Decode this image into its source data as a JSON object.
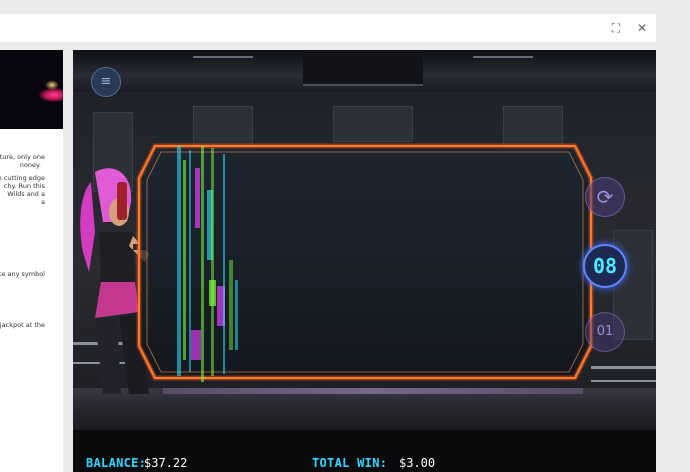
{
  "topbar": {
    "expand_icon": "⛶",
    "close_icon": "✕"
  },
  "left_panel": {
    "lines": [
      "ature, only one",
      "noney.",
      "n cutting edge",
      "chy. Run this",
      "Wilds and a",
      "a",
      "ate any symbol",
      "jackpot at the"
    ]
  },
  "game": {
    "menu_icon": "≡",
    "spin_icon": "⟳",
    "auto_count": "08",
    "bet_label": "01",
    "balance_label": "BALANCE:",
    "balance_value": "$37.22",
    "total_win_label": "TOTAL WIN:",
    "total_win_value": "$3.00"
  },
  "colors": {
    "frame_orange": "#ff5a14",
    "status_cyan": "#2fd7ff",
    "counter_cyan": "#4ce9ff",
    "glitch_green": "#7dff3c",
    "glitch_magenta": "#e040fb",
    "glitch_cyan": "#2ee6ff"
  }
}
